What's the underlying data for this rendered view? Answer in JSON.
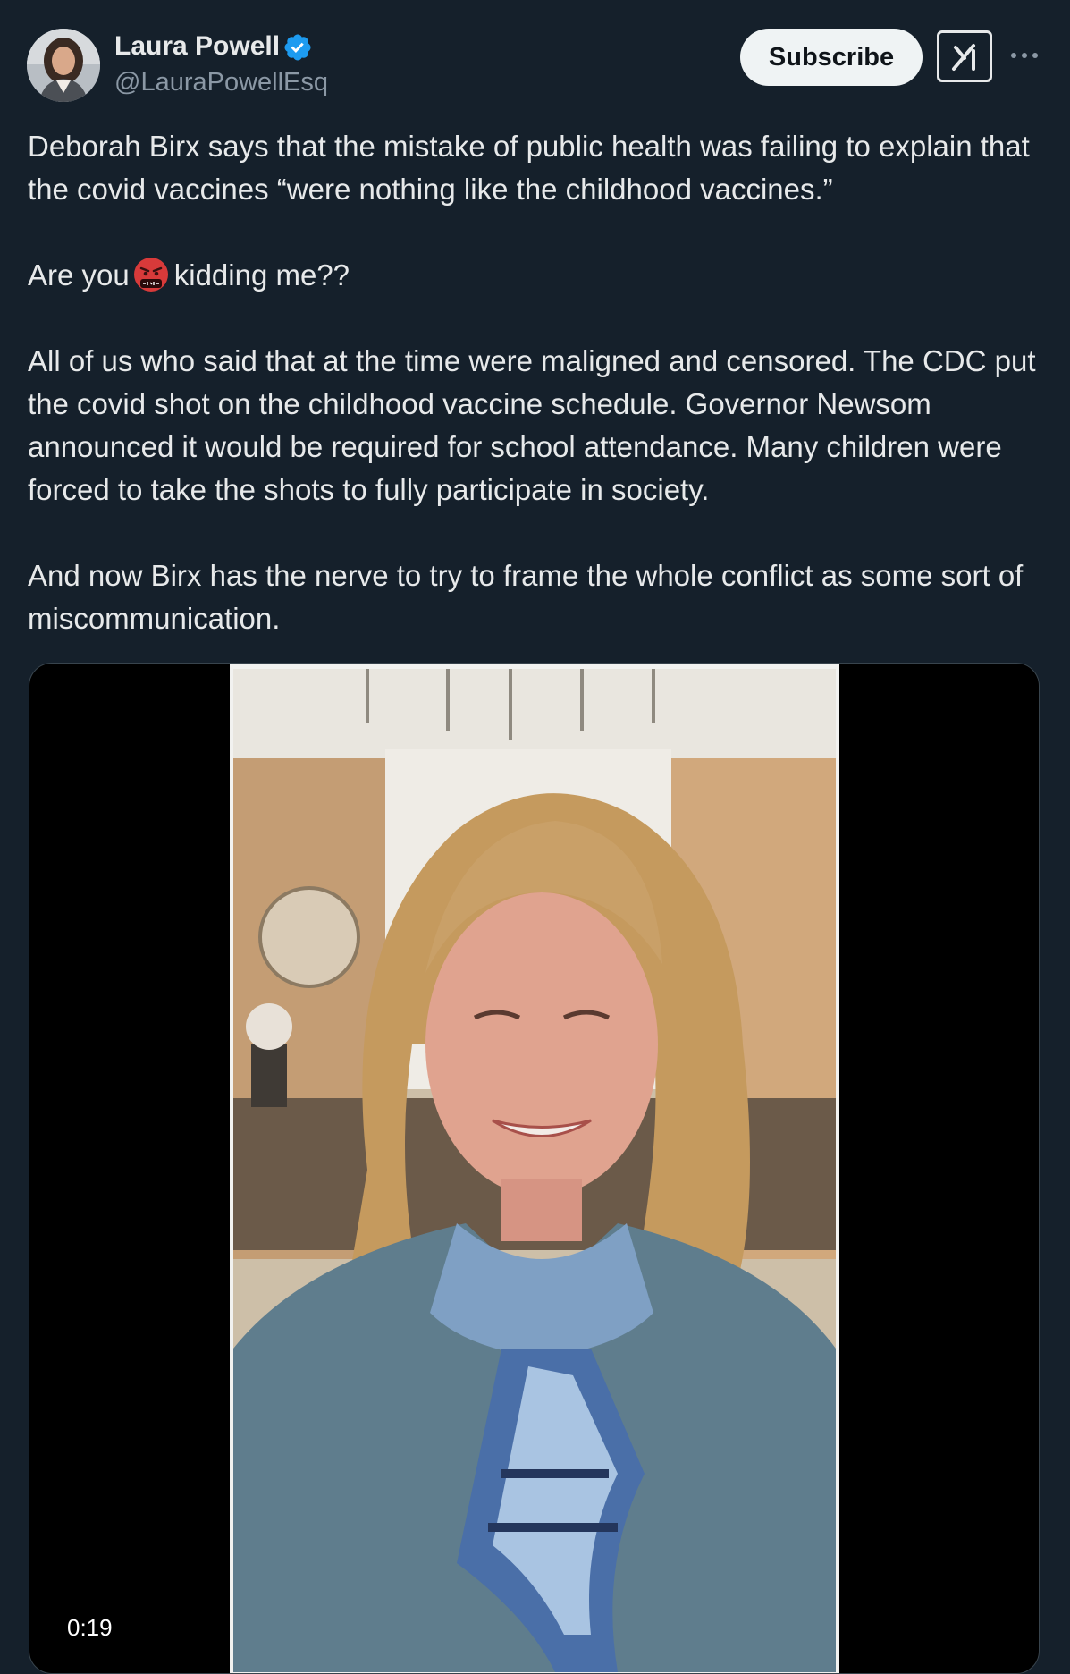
{
  "author": {
    "name": "Laura Powell",
    "handle": "@LauraPowellEsq",
    "verified": true,
    "avatar_icon": "profile-photo"
  },
  "actions": {
    "subscribe_label": "Subscribe",
    "grok_icon": "grok-icon",
    "more_icon": "more-dots-icon"
  },
  "tweet": {
    "para1": "Deborah Birx says that the mistake of public health was failing to explain that the covid vaccines “were nothing like the childhood vaccines.”",
    "para2_before": "Are you",
    "para2_emoji": "face-with-symbols-on-mouth",
    "para2_after": "kidding me??",
    "para3": "All of us who said that at the time were maligned and censored. The CDC put the covid shot on the childhood vaccine schedule. Governor Newsom announced it would be required for school attendance. Many children were forced to take the shots to fully participate in society.",
    "para4": "And now Birx has the nerve to try to frame the whole conflict as some sort of miscommunication."
  },
  "media": {
    "type": "video",
    "duration": "0:19"
  },
  "colors": {
    "background": "#15202b",
    "text": "#e7e9ea",
    "secondary_text": "#8b98a5",
    "verified_blue": "#1d9bf0",
    "subscribe_bg": "#eff3f4"
  }
}
